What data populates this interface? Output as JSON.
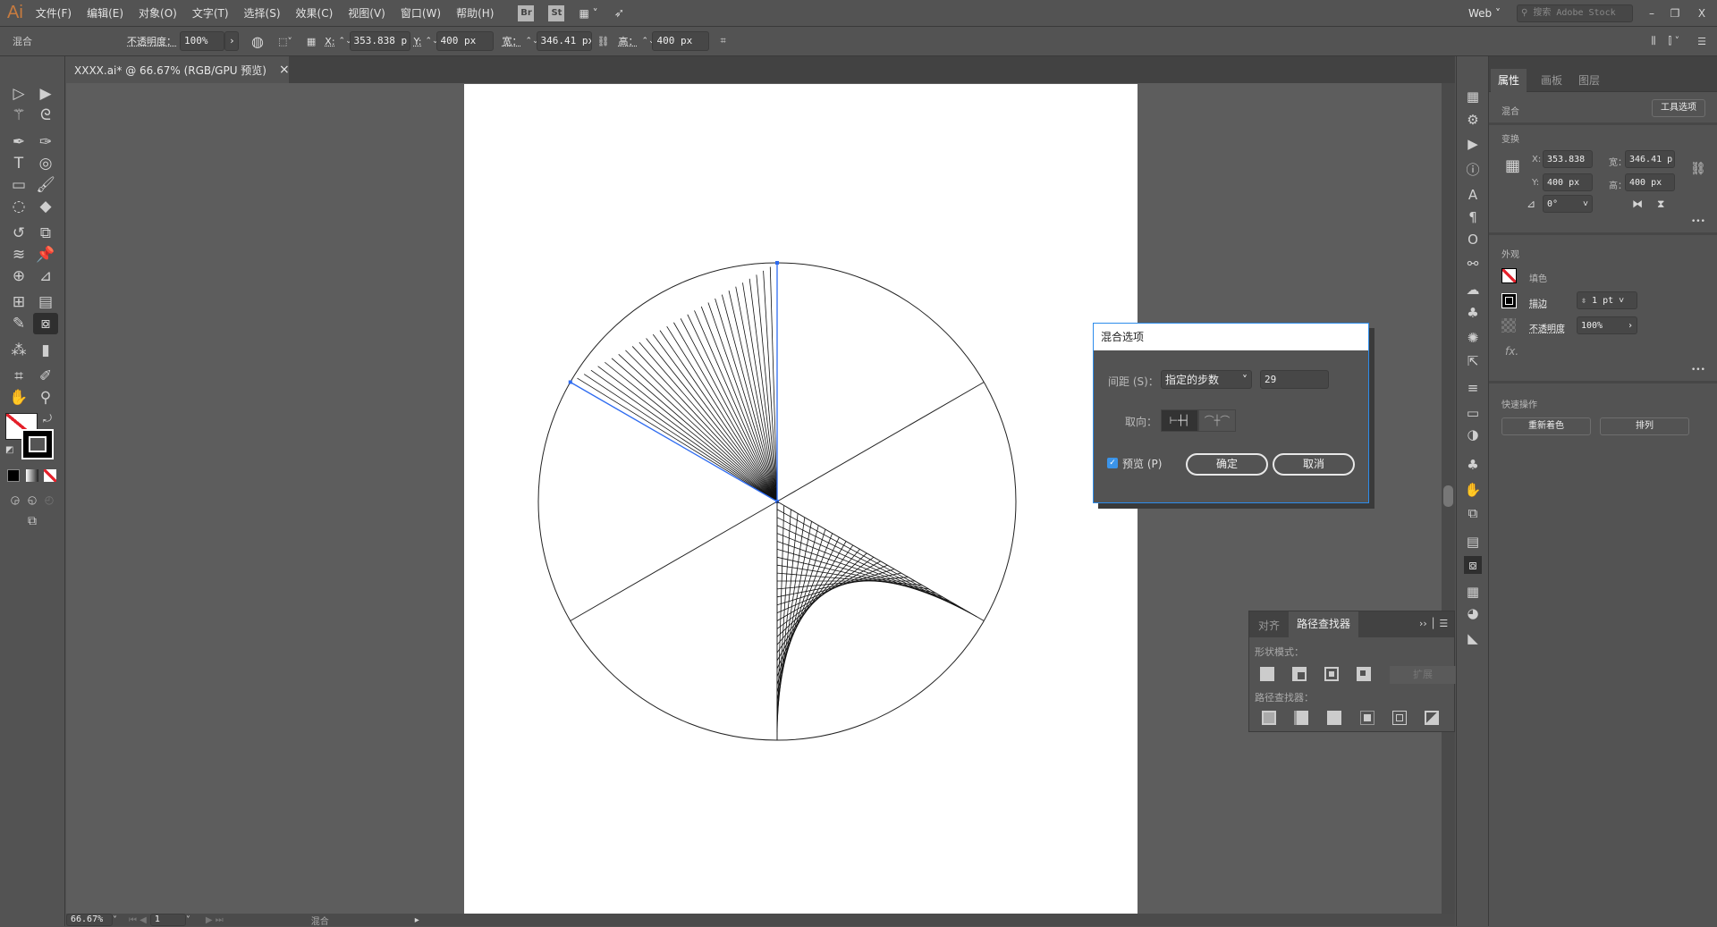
{
  "app": {
    "logo": "Ai",
    "menus": [
      "文件(F)",
      "编辑(E)",
      "对象(O)",
      "文字(T)",
      "选择(S)",
      "效果(C)",
      "视图(V)",
      "窗口(W)",
      "帮助(H)"
    ],
    "bridge": "Br",
    "stock": "St",
    "workspace": "Web",
    "search_placeholder": "搜索 Adobe Stock"
  },
  "control": {
    "mode": "混合",
    "opacity_label": "不透明度：",
    "opacity": "100%",
    "x_label": "X:",
    "x": "353.838 p",
    "y_label": "Y:",
    "y": "400 px",
    "w_label": "宽：",
    "w": "346.41 px",
    "h_label": "高：",
    "h": "400 px"
  },
  "document": {
    "tab": "XXXX.ai* @ 66.67% (RGB/GPU 预览)",
    "close": "×"
  },
  "status": {
    "zoom": "66.67%",
    "artboard": "1",
    "tool": "混合"
  },
  "properties": {
    "tabs": [
      "属性",
      "画板",
      "图层"
    ],
    "object_type": "混合",
    "tool_options": "工具选项",
    "transform_title": "变换",
    "x_label": "X:",
    "x": "353.838",
    "y_label": "Y:",
    "y": "400 px",
    "w_label": "宽：",
    "w": "346.41 p",
    "h_label": "高：",
    "h": "400 px",
    "angle": "0°",
    "appearance_title": "外观",
    "fill_label": "填色",
    "stroke_label": "描边",
    "stroke_weight": "1 pt",
    "opacity_label": "不透明度",
    "opacity": "100%",
    "fx": "fx.",
    "quick_actions_title": "快速操作",
    "recolor": "重新着色",
    "arrange": "排列",
    "more": "•••"
  },
  "blend_dialog": {
    "title": "混合选项",
    "spacing_label": "间距 (S)：",
    "spacing_mode": "指定的步数",
    "steps": "29",
    "orientation_label": "取向：",
    "preview_label": "预览 (P)",
    "preview_checked": true,
    "ok": "确定",
    "cancel": "取消"
  },
  "pathfinder_panel": {
    "tabs": [
      "对齐",
      "路径查找器"
    ],
    "shape_modes_label": "形状模式：",
    "pathfinders_label": "路径查找器：",
    "expand": "扩展"
  },
  "artwork": {
    "blend_steps": 29,
    "selection_color": "#2e6bf0"
  },
  "colors": {
    "accent": "#2d8ceb",
    "none_red": "#e4202a"
  }
}
